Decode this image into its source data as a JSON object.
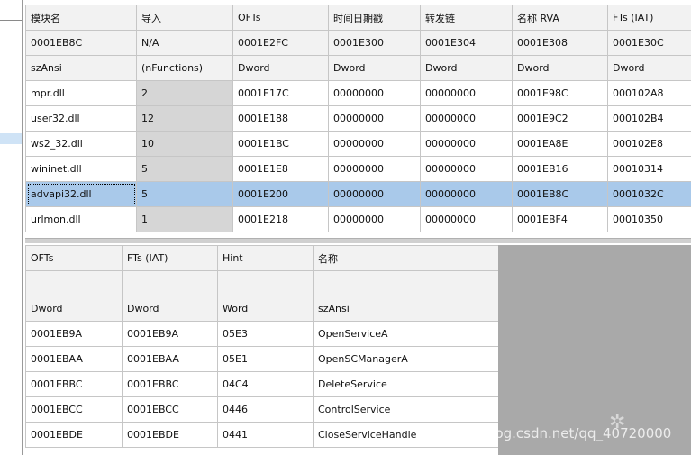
{
  "top_table": {
    "headers": [
      "模块名",
      "导入",
      "OFTs",
      "时间日期戳",
      "转发链",
      "名称 RVA",
      "FTs (IAT)"
    ],
    "offsets": [
      "0001EB8C",
      "N/A",
      "0001E2FC",
      "0001E300",
      "0001E304",
      "0001E308",
      "0001E30C"
    ],
    "types": [
      "szAnsi",
      "(nFunctions)",
      "Dword",
      "Dword",
      "Dword",
      "Dword",
      "Dword"
    ],
    "rows": [
      [
        "mpr.dll",
        "2",
        "0001E17C",
        "00000000",
        "00000000",
        "0001E98C",
        "000102A8"
      ],
      [
        "user32.dll",
        "12",
        "0001E188",
        "00000000",
        "00000000",
        "0001E9C2",
        "000102B4"
      ],
      [
        "ws2_32.dll",
        "10",
        "0001E1BC",
        "00000000",
        "00000000",
        "0001EA8E",
        "000102E8"
      ],
      [
        "wininet.dll",
        "5",
        "0001E1E8",
        "00000000",
        "00000000",
        "0001EB16",
        "00010314"
      ],
      [
        "advapi32.dll",
        "5",
        "0001E200",
        "00000000",
        "00000000",
        "0001EB8C",
        "0001032C"
      ],
      [
        "urlmon.dll",
        "1",
        "0001E218",
        "00000000",
        "00000000",
        "0001EBF4",
        "00010350"
      ]
    ],
    "selected_row": 4
  },
  "bottom_table": {
    "headers": [
      "OFTs",
      "FTs (IAT)",
      "Hint",
      "名称"
    ],
    "blank_row": [
      "",
      "",
      "",
      ""
    ],
    "types": [
      "Dword",
      "Dword",
      "Word",
      "szAnsi"
    ],
    "rows": [
      [
        "0001EB9A",
        "0001EB9A",
        "05E3",
        "OpenServiceA"
      ],
      [
        "0001EBAA",
        "0001EBAA",
        "05E1",
        "OpenSCManagerA"
      ],
      [
        "0001EBBC",
        "0001EBBC",
        "04C4",
        "DeleteService"
      ],
      [
        "0001EBCC",
        "0001EBCC",
        "0446",
        "ControlService"
      ],
      [
        "0001EBDE",
        "0001EBDE",
        "0441",
        "CloseServiceHandle"
      ]
    ]
  },
  "watermark": "https://blog.csdn.net/qq_40720000",
  "colors": {
    "selected_row": "#a9c9ea",
    "header_bg": "#f2f2f2",
    "gray_cell": "#d6d6d6",
    "empty_area": "#a9a9a9"
  }
}
